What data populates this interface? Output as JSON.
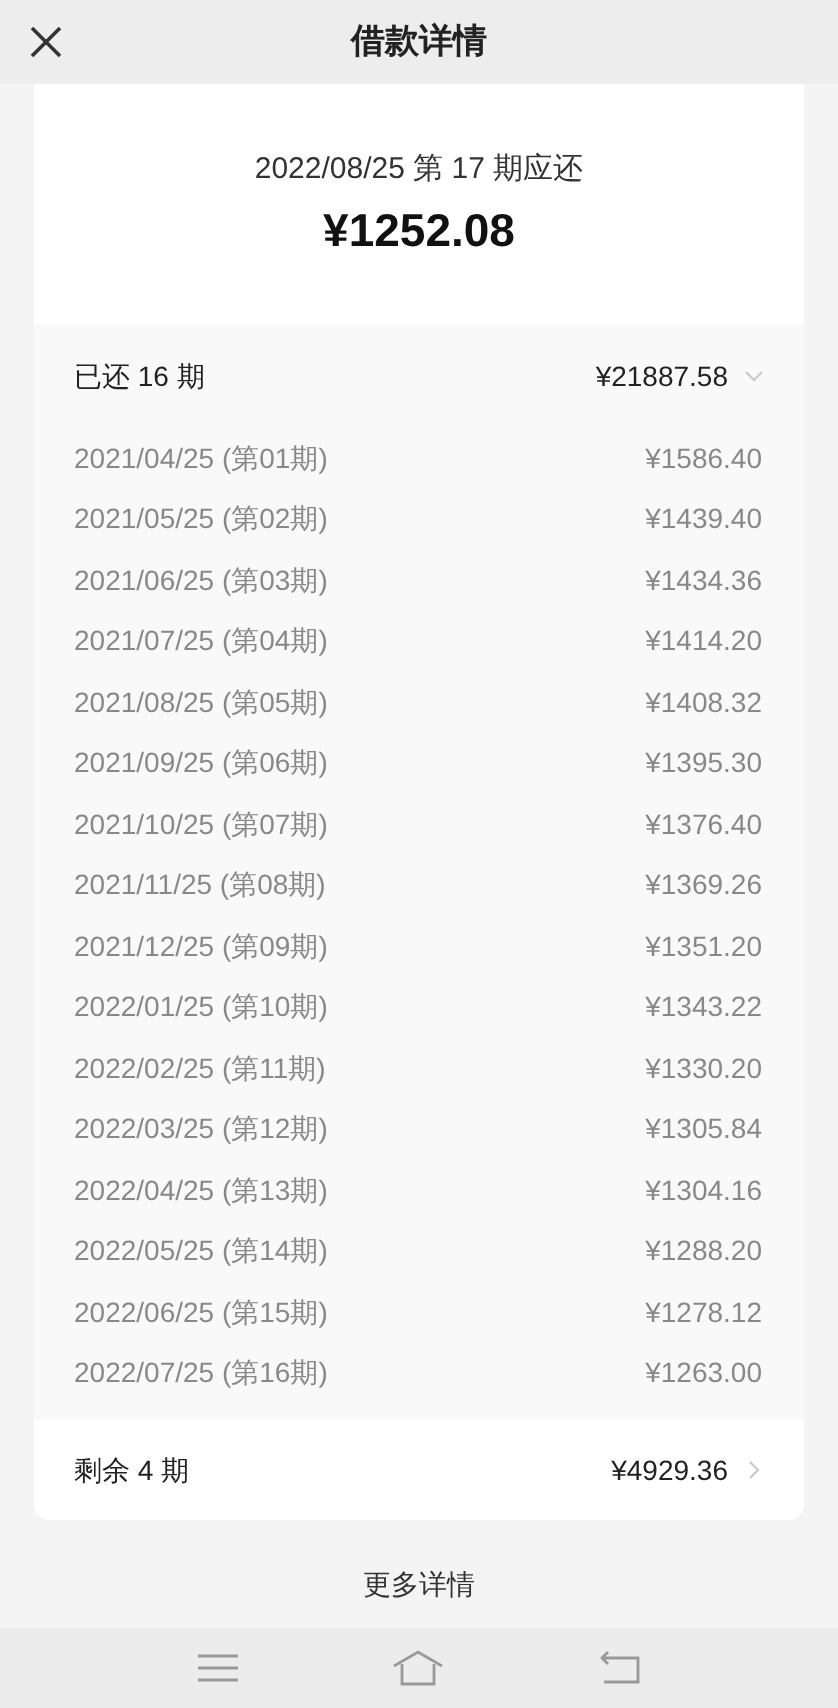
{
  "header": {
    "title": "借款详情"
  },
  "due": {
    "label": "2022/08/25 第 17 期应还",
    "amount": "¥1252.08"
  },
  "paid": {
    "label": "已还 16 期",
    "amount": "¥21887.58",
    "expanded": true,
    "rows": [
      {
        "date": "2021/04/25 (第01期)",
        "amount": "¥1586.40"
      },
      {
        "date": "2021/05/25 (第02期)",
        "amount": "¥1439.40"
      },
      {
        "date": "2021/06/25 (第03期)",
        "amount": "¥1434.36"
      },
      {
        "date": "2021/07/25 (第04期)",
        "amount": "¥1414.20"
      },
      {
        "date": "2021/08/25 (第05期)",
        "amount": "¥1408.32"
      },
      {
        "date": "2021/09/25 (第06期)",
        "amount": "¥1395.30"
      },
      {
        "date": "2021/10/25 (第07期)",
        "amount": "¥1376.40"
      },
      {
        "date": "2021/11/25 (第08期)",
        "amount": "¥1369.26"
      },
      {
        "date": "2021/12/25 (第09期)",
        "amount": "¥1351.20"
      },
      {
        "date": "2022/01/25 (第10期)",
        "amount": "¥1343.22"
      },
      {
        "date": "2022/02/25 (第11期)",
        "amount": "¥1330.20"
      },
      {
        "date": "2022/03/25 (第12期)",
        "amount": "¥1305.84"
      },
      {
        "date": "2022/04/25 (第13期)",
        "amount": "¥1304.16"
      },
      {
        "date": "2022/05/25 (第14期)",
        "amount": "¥1288.20"
      },
      {
        "date": "2022/06/25 (第15期)",
        "amount": "¥1278.12"
      },
      {
        "date": "2022/07/25 (第16期)",
        "amount": "¥1263.00"
      }
    ]
  },
  "remaining": {
    "label": "剩余 4 期",
    "amount": "¥4929.36"
  },
  "more_link": "更多详情"
}
